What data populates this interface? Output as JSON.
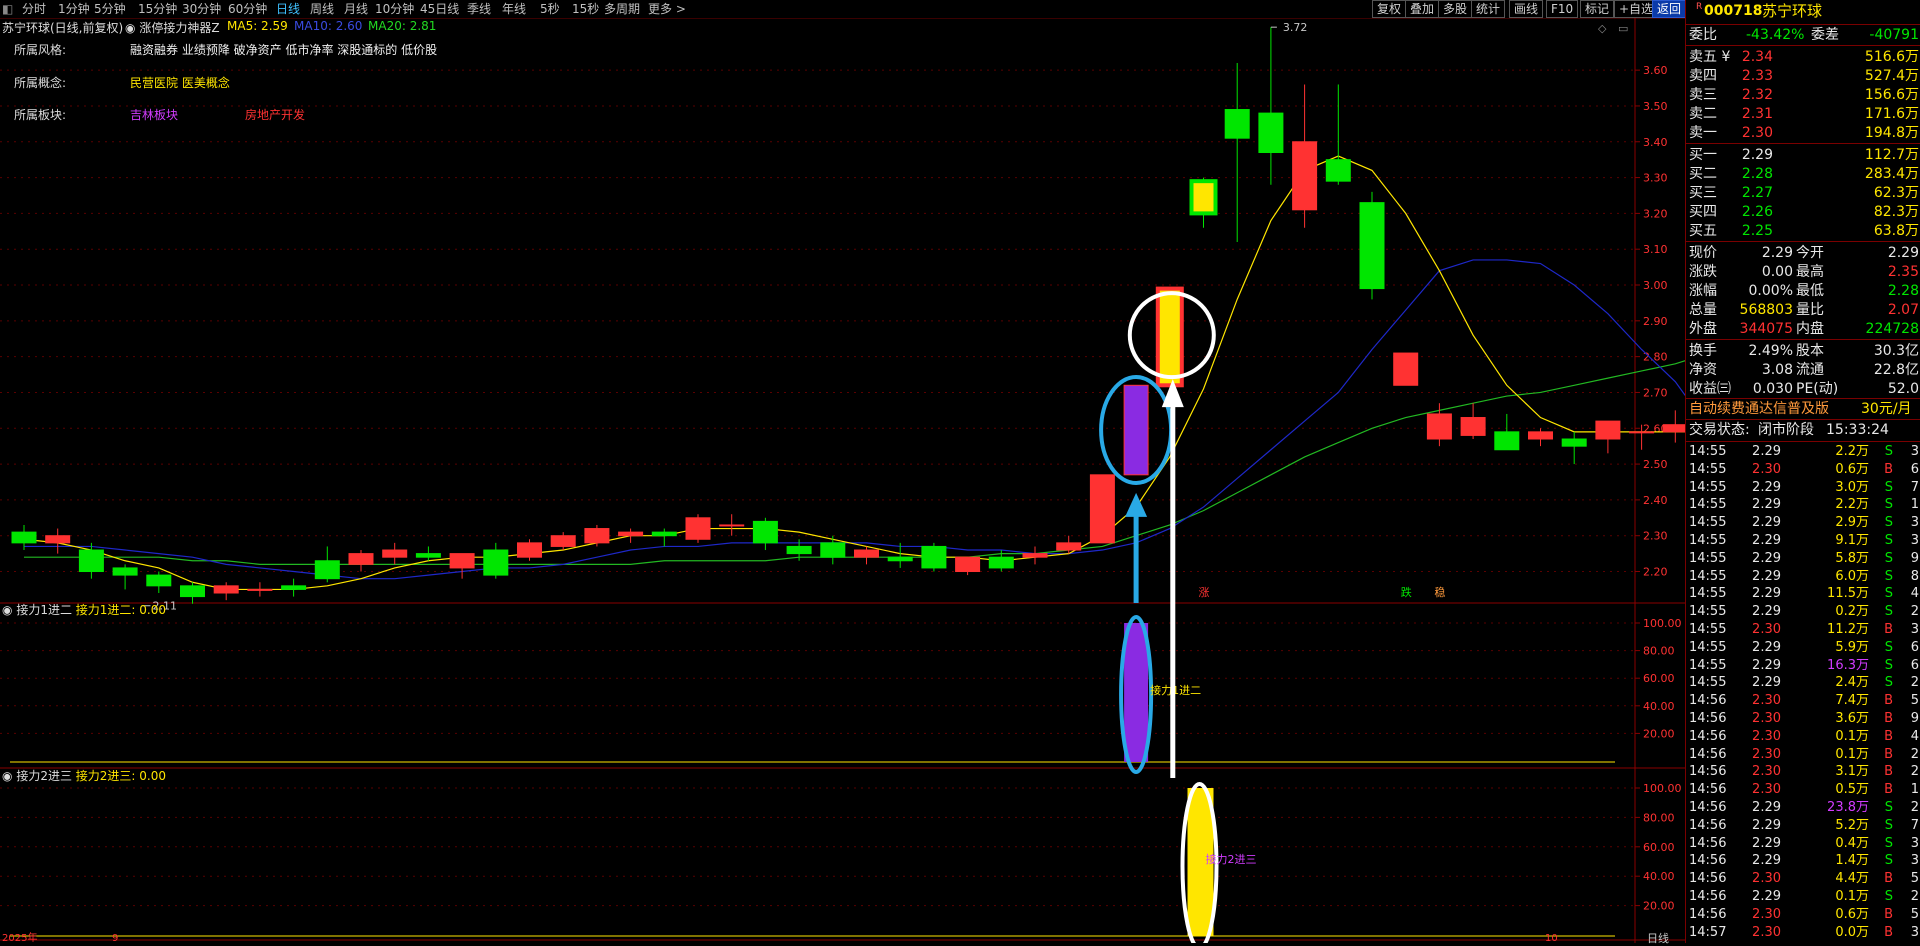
{
  "toolbar": {
    "periods": [
      "分时",
      "1分钟",
      "5分钟",
      "15分钟",
      "30分钟",
      "60分钟",
      "日线",
      "周线",
      "月线",
      "10分钟",
      "45日线",
      "季线",
      "年线",
      "5秒",
      "15秒",
      "多周期",
      "更多 >"
    ],
    "active_period": "日线",
    "right_buttons": [
      "复权",
      "叠加",
      "多股",
      "统计",
      "画线",
      "F10",
      "标记",
      "+自选",
      "返回"
    ]
  },
  "chart_header": {
    "title": "苏宁环球(日线,前复权)",
    "indicator": "涨停接力神器Z",
    "ma5": "MA5: 2.59",
    "ma10": "MA10: 2.60",
    "ma20": "MA20: 2.81"
  },
  "info": {
    "style_label": "所属风格:",
    "style_value": "融资融券 业绩预降 破净资产 低市净率 深股通标的 低价股",
    "concept_label": "所属概念:",
    "concept_value": "民营医院 医美概念",
    "sector_label": "所属板块:",
    "sector_value1": "吉林板块",
    "sector_value2": "房地产开发"
  },
  "colors": {
    "up": "#ff3232",
    "down": "#00e600",
    "ma5": "#ffe600",
    "ma10": "#1e28c8",
    "ma20": "#22b822",
    "accent_cyan": "#29a9e6",
    "purple": "#8a2be2"
  },
  "chart_data": {
    "type": "candlestick",
    "price_axis": [
      "3.60",
      "3.50",
      "3.40",
      "3.30",
      "3.20",
      "3.10",
      "3.00",
      "2.90",
      "2.80",
      "2.70",
      "2.60",
      "2.50",
      "2.40",
      "2.30",
      "2.20"
    ],
    "price_range": [
      2.14,
      3.74
    ],
    "high_label": "3.72",
    "low_label": "2.11",
    "candles": [
      [
        2.31,
        2.33,
        2.26,
        2.28
      ],
      [
        2.28,
        2.32,
        2.25,
        2.3
      ],
      [
        2.26,
        2.28,
        2.18,
        2.2
      ],
      [
        2.21,
        2.22,
        2.15,
        2.19
      ],
      [
        2.19,
        2.2,
        2.14,
        2.16
      ],
      [
        2.16,
        2.17,
        2.11,
        2.13
      ],
      [
        2.14,
        2.17,
        2.12,
        2.16
      ],
      [
        2.15,
        2.17,
        2.13,
        2.15
      ],
      [
        2.16,
        2.18,
        2.13,
        2.15
      ],
      [
        2.23,
        2.27,
        2.17,
        2.18
      ],
      [
        2.22,
        2.26,
        2.2,
        2.25
      ],
      [
        2.24,
        2.28,
        2.22,
        2.26
      ],
      [
        2.25,
        2.27,
        2.23,
        2.24
      ],
      [
        2.21,
        2.25,
        2.18,
        2.25
      ],
      [
        2.26,
        2.28,
        2.18,
        2.19
      ],
      [
        2.24,
        2.29,
        2.23,
        2.28
      ],
      [
        2.27,
        2.31,
        2.26,
        2.3
      ],
      [
        2.28,
        2.33,
        2.27,
        2.32
      ],
      [
        2.3,
        2.32,
        2.28,
        2.31
      ],
      [
        2.31,
        2.32,
        2.27,
        2.3
      ],
      [
        2.29,
        2.36,
        2.28,
        2.35
      ],
      [
        2.33,
        2.36,
        2.3,
        2.33
      ],
      [
        2.34,
        2.35,
        2.26,
        2.28
      ],
      [
        2.27,
        2.29,
        2.23,
        2.25
      ],
      [
        2.28,
        2.3,
        2.22,
        2.24
      ],
      [
        2.24,
        2.27,
        2.22,
        2.26
      ],
      [
        2.24,
        2.28,
        2.21,
        2.23
      ],
      [
        2.27,
        2.28,
        2.2,
        2.21
      ],
      [
        2.2,
        2.24,
        2.19,
        2.24
      ],
      [
        2.24,
        2.26,
        2.2,
        2.21
      ],
      [
        2.24,
        2.27,
        2.22,
        2.25
      ],
      [
        2.26,
        2.3,
        2.25,
        2.28
      ],
      [
        2.28,
        2.47,
        2.28,
        2.47
      ],
      [
        2.47,
        2.72,
        2.47,
        2.72
      ],
      [
        2.72,
        2.99,
        2.72,
        2.99
      ],
      [
        3.29,
        3.3,
        3.16,
        3.2
      ],
      [
        3.49,
        3.62,
        3.12,
        3.41
      ],
      [
        3.48,
        3.72,
        3.28,
        3.37
      ],
      [
        3.21,
        3.56,
        3.16,
        3.4
      ],
      [
        3.35,
        3.56,
        3.28,
        3.29
      ],
      [
        3.23,
        3.26,
        2.96,
        2.99
      ],
      [
        2.72,
        2.81,
        2.72,
        2.81
      ],
      [
        2.57,
        2.67,
        2.55,
        2.64
      ],
      [
        2.58,
        2.67,
        2.57,
        2.63
      ],
      [
        2.59,
        2.64,
        2.55,
        2.54
      ],
      [
        2.57,
        2.6,
        2.55,
        2.59
      ],
      [
        2.57,
        2.59,
        2.5,
        2.55
      ],
      [
        2.57,
        2.62,
        2.53,
        2.62
      ],
      [
        2.59,
        2.61,
        2.54,
        2.59
      ],
      [
        2.59,
        2.65,
        2.56,
        2.61
      ],
      [
        2.6,
        2.61,
        2.51,
        2.53
      ]
    ],
    "ma5": [
      2.29,
      2.28,
      2.26,
      2.23,
      2.21,
      2.17,
      2.15,
      2.15,
      2.15,
      2.16,
      2.18,
      2.21,
      2.23,
      2.24,
      2.24,
      2.25,
      2.26,
      2.28,
      2.3,
      2.3,
      2.32,
      2.32,
      2.32,
      2.31,
      2.29,
      2.27,
      2.25,
      2.24,
      2.24,
      2.23,
      2.24,
      2.25,
      2.3,
      2.38,
      2.52,
      2.71,
      2.96,
      3.18,
      3.32,
      3.36,
      3.32,
      3.2,
      3.04,
      2.86,
      2.72,
      2.63,
      2.59,
      2.59,
      2.59,
      2.59,
      2.59
    ],
    "ma10": [
      2.27,
      2.27,
      2.27,
      2.26,
      2.25,
      2.24,
      2.22,
      2.21,
      2.2,
      2.19,
      2.18,
      2.18,
      2.19,
      2.2,
      2.21,
      2.21,
      2.22,
      2.24,
      2.26,
      2.27,
      2.27,
      2.28,
      2.28,
      2.28,
      2.28,
      2.28,
      2.27,
      2.27,
      2.26,
      2.26,
      2.25,
      2.25,
      2.26,
      2.28,
      2.32,
      2.38,
      2.46,
      2.54,
      2.62,
      2.7,
      2.82,
      2.93,
      3.04,
      3.07,
      3.07,
      3.06,
      3.0,
      2.92,
      2.82,
      2.73,
      2.6
    ],
    "ma20": [
      2.24,
      2.24,
      2.24,
      2.24,
      2.24,
      2.23,
      2.23,
      2.22,
      2.22,
      2.22,
      2.22,
      2.22,
      2.22,
      2.22,
      2.22,
      2.22,
      2.22,
      2.22,
      2.22,
      2.23,
      2.23,
      2.23,
      2.23,
      2.24,
      2.24,
      2.24,
      2.24,
      2.24,
      2.24,
      2.25,
      2.25,
      2.26,
      2.27,
      2.3,
      2.33,
      2.37,
      2.42,
      2.47,
      2.52,
      2.56,
      2.6,
      2.63,
      2.65,
      2.67,
      2.69,
      2.7,
      2.72,
      2.74,
      2.76,
      2.78,
      2.81
    ],
    "signals": [
      {
        "text": "涨",
        "color": "#ff3232"
      },
      {
        "text": "跌",
        "color": "#00e600"
      },
      {
        "text": "稳",
        "color": "#ff9a3c"
      }
    ],
    "sub1": {
      "title": "接力1进二",
      "value_label": "接力1进二: 0.00",
      "axis": [
        "100.00",
        "80.00",
        "60.00",
        "40.00",
        "20.00"
      ],
      "bar_value": 100,
      "annotation": "接力1进二"
    },
    "sub2": {
      "title": "接力2进三",
      "value_label": "接力2进三: 0.00",
      "axis": [
        "100.00",
        "80.00",
        "60.00",
        "40.00",
        "20.00"
      ],
      "bar_value": 100,
      "annotation": "接力2进三"
    },
    "date_axis": [
      "2025年",
      "9",
      "",
      "10"
    ]
  },
  "panel": {
    "code": "000718",
    "name": "苏宁环球",
    "ratio_label": "委比",
    "ratio": "-43.42%",
    "diff_label": "委差",
    "diff": "-40791",
    "sells": [
      {
        "label": "卖五 ¥",
        "price": "2.34",
        "vol": "516.6万"
      },
      {
        "label": "卖四",
        "price": "2.33",
        "vol": "527.4万"
      },
      {
        "label": "卖三",
        "price": "2.32",
        "vol": "156.6万"
      },
      {
        "label": "卖二",
        "price": "2.31",
        "vol": "171.6万"
      },
      {
        "label": "卖一",
        "price": "2.30",
        "vol": "194.8万"
      }
    ],
    "buys": [
      {
        "label": "买一",
        "price": "2.29",
        "vol": "112.7万"
      },
      {
        "label": "买二",
        "price": "2.28",
        "vol": "283.4万"
      },
      {
        "label": "买三",
        "price": "2.27",
        "vol": "62.3万"
      },
      {
        "label": "买四",
        "price": "2.26",
        "vol": "82.3万"
      },
      {
        "label": "买五",
        "price": "2.25",
        "vol": "63.8万"
      }
    ],
    "stats": [
      {
        "l1": "现价",
        "v1": "2.29",
        "c1": "white",
        "l2": "今开",
        "v2": "2.29",
        "c2": "white"
      },
      {
        "l1": "涨跌",
        "v1": "0.00",
        "c1": "white",
        "l2": "最高",
        "v2": "2.35",
        "c2": "red"
      },
      {
        "l1": "涨幅",
        "v1": "0.00%",
        "c1": "white",
        "l2": "最低",
        "v2": "2.28",
        "c2": "green"
      },
      {
        "l1": "总量",
        "v1": "568803",
        "c1": "yellow",
        "l2": "量比",
        "v2": "2.07",
        "c2": "red"
      },
      {
        "l1": "外盘",
        "v1": "344075",
        "c1": "red",
        "l2": "内盘",
        "v2": "224728",
        "c2": "green"
      }
    ],
    "stats2": [
      {
        "l1": "换手",
        "v1": "2.49%",
        "l2": "股本",
        "v2": "30.3亿"
      },
      {
        "l1": "净资",
        "v1": "3.08",
        "l2": "流通",
        "v2": "22.8亿"
      },
      {
        "l1": "收益㈢",
        "v1": "0.030",
        "l2": "PE(动)",
        "v2": "52.0"
      }
    ],
    "promo": "自动续费通达信普及版",
    "promo_price": "30元/月",
    "status_label": "交易状态:",
    "status_value": "闭市阶段",
    "status_time": "15:33:24",
    "ticks": [
      {
        "t": "14:55",
        "p": "2.29",
        "v": "2.2万",
        "d": "S",
        "n": "3"
      },
      {
        "t": "14:55",
        "p": "2.30",
        "v": "0.6万",
        "d": "B",
        "n": "6"
      },
      {
        "t": "14:55",
        "p": "2.29",
        "v": "3.0万",
        "d": "S",
        "n": "7"
      },
      {
        "t": "14:55",
        "p": "2.29",
        "v": "2.2万",
        "d": "S",
        "n": "1"
      },
      {
        "t": "14:55",
        "p": "2.29",
        "v": "2.9万",
        "d": "S",
        "n": "3"
      },
      {
        "t": "14:55",
        "p": "2.29",
        "v": "9.1万",
        "d": "S",
        "n": "3"
      },
      {
        "t": "14:55",
        "p": "2.29",
        "v": "5.8万",
        "d": "S",
        "n": "9"
      },
      {
        "t": "14:55",
        "p": "2.29",
        "v": "6.0万",
        "d": "S",
        "n": "8"
      },
      {
        "t": "14:55",
        "p": "2.29",
        "v": "11.5万",
        "d": "S",
        "n": "4"
      },
      {
        "t": "14:55",
        "p": "2.29",
        "v": "0.2万",
        "d": "S",
        "n": "2"
      },
      {
        "t": "14:55",
        "p": "2.30",
        "v": "11.2万",
        "d": "B",
        "n": "3"
      },
      {
        "t": "14:55",
        "p": "2.29",
        "v": "5.9万",
        "d": "S",
        "n": "6"
      },
      {
        "t": "14:55",
        "p": "2.29",
        "v": "16.3万",
        "d": "S",
        "n": "6"
      },
      {
        "t": "14:55",
        "p": "2.29",
        "v": "2.4万",
        "d": "S",
        "n": "2"
      },
      {
        "t": "14:56",
        "p": "2.30",
        "v": "7.4万",
        "d": "B",
        "n": "5"
      },
      {
        "t": "14:56",
        "p": "2.30",
        "v": "3.6万",
        "d": "B",
        "n": "9"
      },
      {
        "t": "14:56",
        "p": "2.30",
        "v": "0.1万",
        "d": "B",
        "n": "4"
      },
      {
        "t": "14:56",
        "p": "2.30",
        "v": "0.1万",
        "d": "B",
        "n": "2"
      },
      {
        "t": "14:56",
        "p": "2.30",
        "v": "3.1万",
        "d": "B",
        "n": "2"
      },
      {
        "t": "14:56",
        "p": "2.30",
        "v": "0.5万",
        "d": "B",
        "n": "1"
      },
      {
        "t": "14:56",
        "p": "2.29",
        "v": "23.8万",
        "d": "S",
        "n": "2"
      },
      {
        "t": "14:56",
        "p": "2.29",
        "v": "5.2万",
        "d": "S",
        "n": "7"
      },
      {
        "t": "14:56",
        "p": "2.29",
        "v": "0.4万",
        "d": "S",
        "n": "3"
      },
      {
        "t": "14:56",
        "p": "2.29",
        "v": "1.4万",
        "d": "S",
        "n": "3"
      },
      {
        "t": "14:56",
        "p": "2.30",
        "v": "4.4万",
        "d": "B",
        "n": "5"
      },
      {
        "t": "14:56",
        "p": "2.29",
        "v": "0.1万",
        "d": "S",
        "n": "2"
      },
      {
        "t": "14:56",
        "p": "2.30",
        "v": "0.6万",
        "d": "B",
        "n": "5"
      },
      {
        "t": "14:57",
        "p": "2.30",
        "v": "0.0万",
        "d": "B",
        "n": "3"
      }
    ]
  },
  "bottom_right_label": "日线"
}
